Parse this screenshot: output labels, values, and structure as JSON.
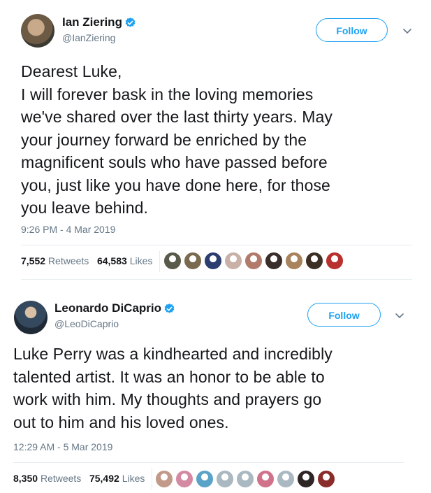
{
  "tweets": [
    {
      "display_name": "Ian Ziering",
      "handle": "@IanZiering",
      "follow_label": "Follow",
      "text": "Dearest Luke,\nI will forever bask in the loving memories\nwe've shared over the last thirty years. May\nyour journey forward be enriched by the\nmagnificent souls who have passed before\nyou, just like you have done here, for those\nyou leave behind.",
      "timestamp": "9:26 PM - 4 Mar 2019",
      "retweets_count": "7,552",
      "retweets_label": "Retweets",
      "likes_count": "64,583",
      "likes_label": "Likes",
      "liker_colors": [
        "#5a5a4a",
        "#7a6a50",
        "#2c3e70",
        "#c9b1a8",
        "#b27a6a",
        "#3a2e2a",
        "#a8835c",
        "#3b2f26",
        "#b8312f"
      ]
    },
    {
      "display_name": "Leonardo DiCaprio",
      "handle": "@LeoDiCaprio",
      "follow_label": "Follow",
      "text": "Luke Perry was a kindhearted and incredibly\ntalented artist. It was an honor to be able to\nwork with him. My thoughts and prayers go\nout to him and his loved ones.",
      "timestamp": "12:29 AM - 5 Mar 2019",
      "retweets_count": "8,350",
      "retweets_label": "Retweets",
      "likes_count": "75,492",
      "likes_label": "Likes",
      "liker_colors": [
        "#c29a8a",
        "#d48aa0",
        "#5aa3c8",
        "#aab8c2",
        "#aab8c2",
        "#d0728a",
        "#aab8c2",
        "#2e2624",
        "#8a2c2a"
      ]
    }
  ],
  "colors": {
    "accent": "#1da1f2",
    "text": "#14171a",
    "secondary": "#657786",
    "divider": "#e6ecf0"
  }
}
